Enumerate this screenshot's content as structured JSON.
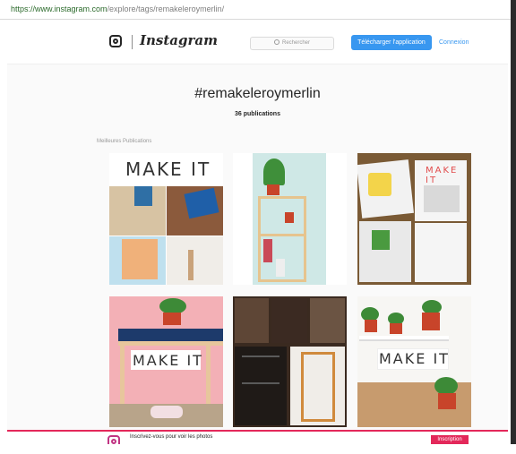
{
  "browser": {
    "url_host": "https://www.instagram.com",
    "url_path": "/explore/tags/remakeleroymerlin/"
  },
  "header": {
    "logo_text": "Instagram",
    "search_placeholder": "Rechercher",
    "download_button": "Télécharger l'application",
    "login_link": "Connexion"
  },
  "tag": {
    "title": "#remakeleroymerlin",
    "count": "36 publications",
    "section_label": "Meilleures Publications"
  },
  "posts": [
    {
      "overlay_text": "MAKE IT"
    },
    {
      "overlay_text": ""
    },
    {
      "overlay_text": "MAKE IT"
    },
    {
      "overlay_text": "MAKE IT"
    },
    {
      "overlay_text": ""
    },
    {
      "overlay_text": "MAKE IT"
    }
  ],
  "footer": {
    "text": "Inscrivez-vous pour voir les photos",
    "signup_button": "Inscription"
  },
  "colors": {
    "brand_blue": "#3897f0",
    "footer_accent": "#e3285a",
    "background": "#fafafa"
  }
}
